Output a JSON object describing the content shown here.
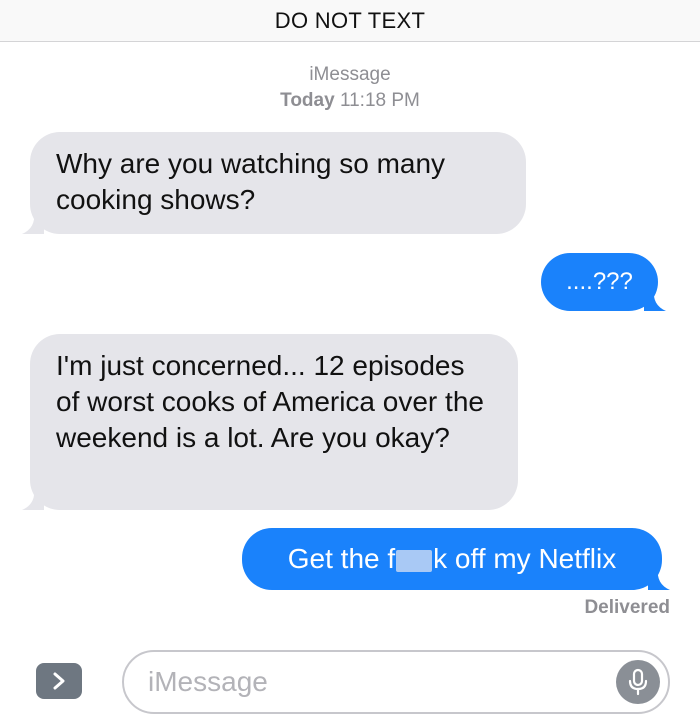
{
  "header": {
    "title": "DO NOT TEXT"
  },
  "conversation": {
    "service": "iMessage",
    "day": "Today",
    "time": "11:18 PM"
  },
  "messages": [
    {
      "direction": "incoming",
      "text": "Why are you watching so many cooking shows?"
    },
    {
      "direction": "outgoing",
      "text": "....???"
    },
    {
      "direction": "incoming",
      "text": "I'm just concerned... 12 episodes of worst cooks of America over the weekend is a lot. Are you okay?"
    },
    {
      "direction": "outgoing",
      "text_before_censor": "Get the f",
      "text_after_censor": "k off my Netflix"
    }
  ],
  "delivery_status": "Delivered",
  "compose": {
    "placeholder": "iMessage"
  },
  "icons": {
    "expand": "chevron-right-icon",
    "mic": "microphone-icon"
  },
  "colors": {
    "outgoing_bubble": "#1a82fb",
    "incoming_bubble": "#e5e5ea"
  }
}
